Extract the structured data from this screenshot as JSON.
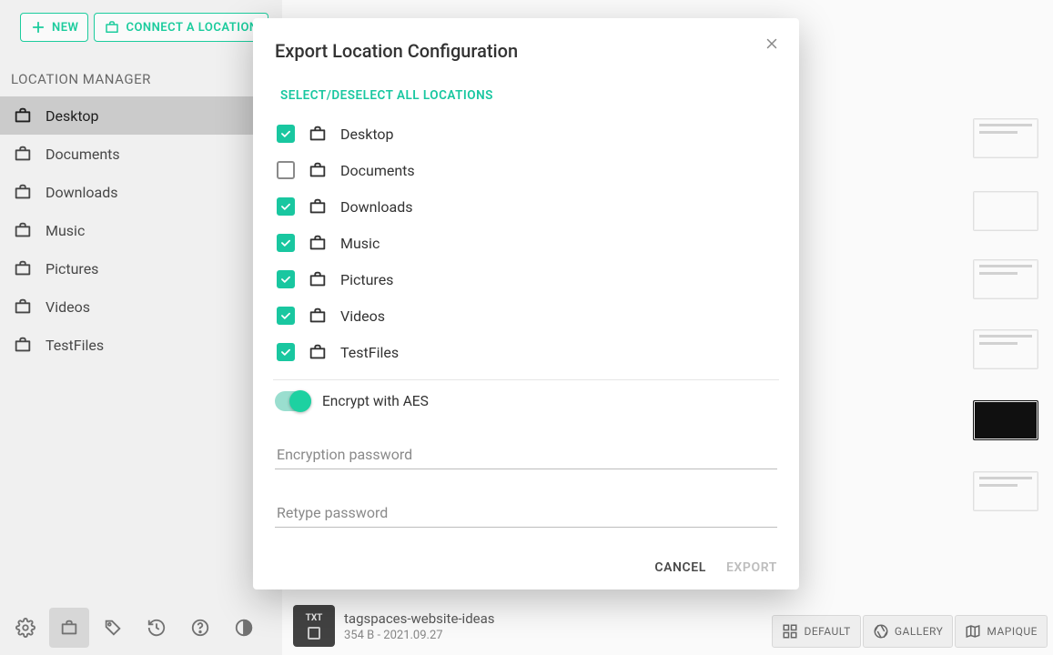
{
  "sidebar": {
    "new_label": "NEW",
    "connect_label": "CONNECT A LOCATION",
    "section_title": "LOCATION MANAGER",
    "items": [
      {
        "label": "Desktop",
        "active": true
      },
      {
        "label": "Documents",
        "active": false
      },
      {
        "label": "Downloads",
        "active": false
      },
      {
        "label": "Music",
        "active": false
      },
      {
        "label": "Pictures",
        "active": false
      },
      {
        "label": "Videos",
        "active": false
      },
      {
        "label": "TestFiles",
        "active": false
      }
    ]
  },
  "dialog": {
    "title": "Export Location Configuration",
    "select_all": "SELECT/DESELECT ALL LOCATIONS",
    "locations": [
      {
        "label": "Desktop",
        "checked": true
      },
      {
        "label": "Documents",
        "checked": false
      },
      {
        "label": "Downloads",
        "checked": true
      },
      {
        "label": "Music",
        "checked": true
      },
      {
        "label": "Pictures",
        "checked": true
      },
      {
        "label": "Videos",
        "checked": true
      },
      {
        "label": "TestFiles",
        "checked": true
      }
    ],
    "encrypt_label": "Encrypt with AES",
    "encrypt_on": true,
    "password_placeholder": "Encryption password",
    "password2_placeholder": "Retype password",
    "cancel": "CANCEL",
    "export": "EXPORT"
  },
  "footer_file": {
    "ext": "TXT",
    "name": "tagspaces-website-ideas",
    "meta": "354 B - 2021.09.27"
  },
  "views": {
    "default": "DEFAULT",
    "gallery": "GALLERY",
    "mapique": "MAPIQUE"
  }
}
